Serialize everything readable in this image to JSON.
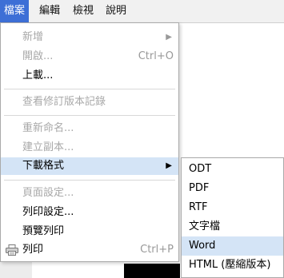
{
  "menubar": {
    "items": [
      "檔案",
      "編輯",
      "檢視",
      "說明"
    ]
  },
  "file_menu": {
    "items": [
      {
        "label": "新增",
        "disabled": true,
        "submenu": true
      },
      {
        "label": "開啟...",
        "disabled": true,
        "shortcut": "Ctrl+O"
      },
      {
        "label": "上載..."
      },
      {
        "label": "查看修訂版本記錄",
        "disabled": true
      },
      {
        "label": "重新命名...",
        "disabled": true
      },
      {
        "label": "建立副本...",
        "disabled": true
      },
      {
        "label": "下載格式",
        "submenu": true,
        "highlighted": true
      },
      {
        "label": "頁面設定...",
        "disabled": true
      },
      {
        "label": "列印設定..."
      },
      {
        "label": "預覽列印"
      },
      {
        "label": "列印",
        "shortcut": "Ctrl+P",
        "icon": "printer-icon"
      }
    ],
    "submenu_arrow": "▶"
  },
  "download_submenu": {
    "items": [
      {
        "label": "ODT"
      },
      {
        "label": "PDF"
      },
      {
        "label": "RTF"
      },
      {
        "label": "文字檔"
      },
      {
        "label": "Word",
        "highlighted": true
      },
      {
        "label": "HTML (壓縮版本)"
      }
    ]
  },
  "colors": {
    "menubar_active": "#3d6fd6",
    "highlight": "#d4e4f6",
    "disabled_text": "#a8a8a8"
  }
}
